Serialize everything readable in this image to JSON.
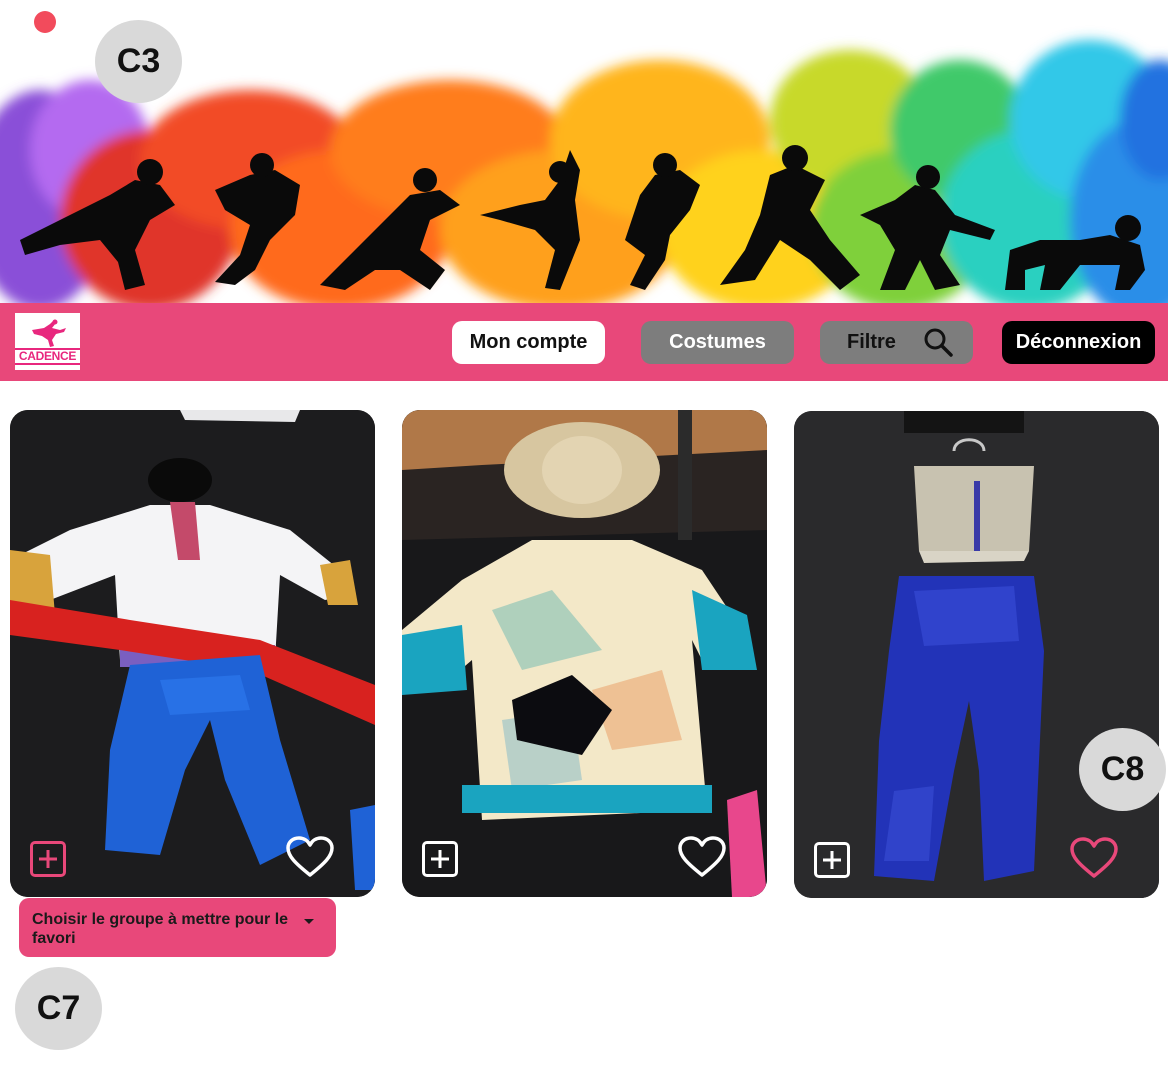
{
  "navbar": {
    "logo_text": "CADENCE",
    "buttons": {
      "account": "Mon compte",
      "costumes": "Costumes",
      "filter": "Filtre",
      "logout": "Déconnexion"
    }
  },
  "cards": [
    {
      "description_icon": "plus-square-icon",
      "favorite_icon": "heart-outline-icon",
      "favorited": false
    },
    {
      "description_icon": "plus-square-icon",
      "favorite_icon": "heart-outline-icon",
      "favorited": false
    },
    {
      "description_icon": "plus-square-icon",
      "favorite_icon": "heart-outline-icon",
      "favorited": true
    }
  ],
  "group_select": {
    "label": "Choisir le groupe à mettre pour le favori"
  },
  "annotations": {
    "c3": "C3",
    "c7": "C7",
    "c8": "C8"
  },
  "colors": {
    "brand_pink": "#e8487a",
    "nav_gray": "#7d7d7d",
    "logout_black": "#000000"
  }
}
